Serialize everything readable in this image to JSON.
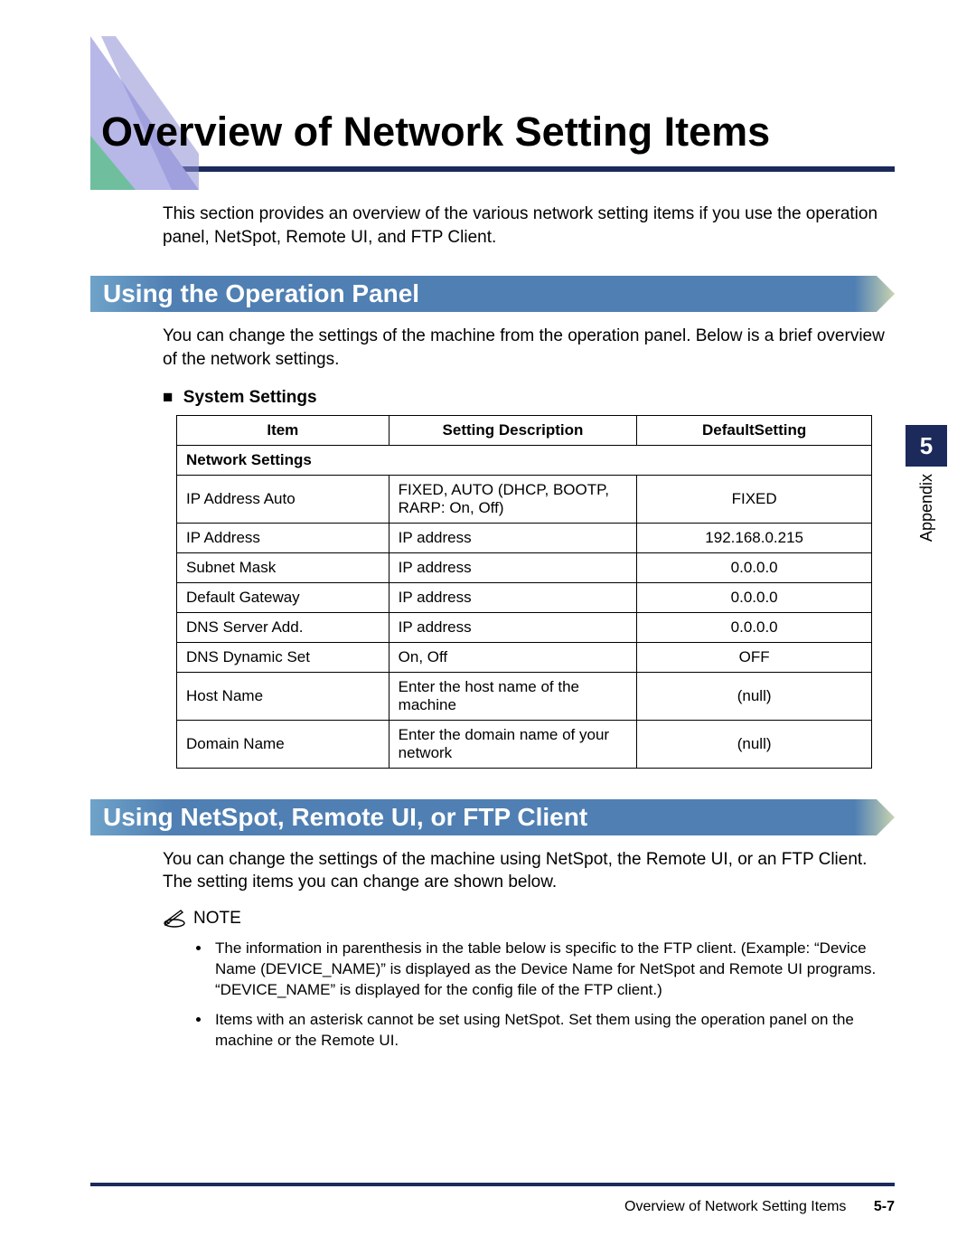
{
  "title": "Overview of Network Setting Items",
  "intro": "This section provides an overview of the various network setting items if you use the operation panel, NetSpot, Remote UI, and FTP Client.",
  "section1": {
    "title": "Using the Operation Panel",
    "intro": "You can change the settings of the machine from the operation panel. Below is a brief overview of the network settings.",
    "subhead": "System Settings",
    "table": {
      "headers": {
        "item": "Item",
        "desc": "Setting Description",
        "def": "DefaultSetting"
      },
      "category": "Network Settings",
      "rows": [
        {
          "item": "IP Address Auto",
          "desc": "FIXED, AUTO (DHCP, BOOTP, RARP: On, Off)",
          "def": "FIXED"
        },
        {
          "item": "IP Address",
          "desc": "IP address",
          "def": "192.168.0.215"
        },
        {
          "item": "Subnet Mask",
          "desc": "IP address",
          "def": "0.0.0.0"
        },
        {
          "item": "Default Gateway",
          "desc": "IP address",
          "def": "0.0.0.0"
        },
        {
          "item": "DNS Server Add.",
          "desc": "IP address",
          "def": "0.0.0.0"
        },
        {
          "item": "DNS Dynamic Set",
          "desc": "On, Off",
          "def": "OFF"
        },
        {
          "item": "Host Name",
          "desc": "Enter the host name of the machine",
          "def": "(null)"
        },
        {
          "item": "Domain Name",
          "desc": "Enter the domain name of your network",
          "def": "(null)"
        }
      ]
    }
  },
  "section2": {
    "title": "Using NetSpot, Remote UI, or FTP Client",
    "intro": "You can change the settings of the machine using NetSpot, the Remote UI, or an FTP Client. The setting items you can change are shown below.",
    "note_label": "NOTE",
    "notes": [
      "The information in parenthesis in the table below is specific to the FTP client. (Example: “Device Name (DEVICE_NAME)” is displayed as the Device Name for NetSpot and Remote UI programs. “DEVICE_NAME” is displayed for the config file of the FTP client.)",
      "Items with an asterisk cannot be set using NetSpot. Set them using the operation panel on the machine or the Remote UI."
    ]
  },
  "sidetab": {
    "number": "5",
    "label": "Appendix"
  },
  "footer": {
    "title": "Overview of Network Setting Items",
    "page": "5-7"
  }
}
